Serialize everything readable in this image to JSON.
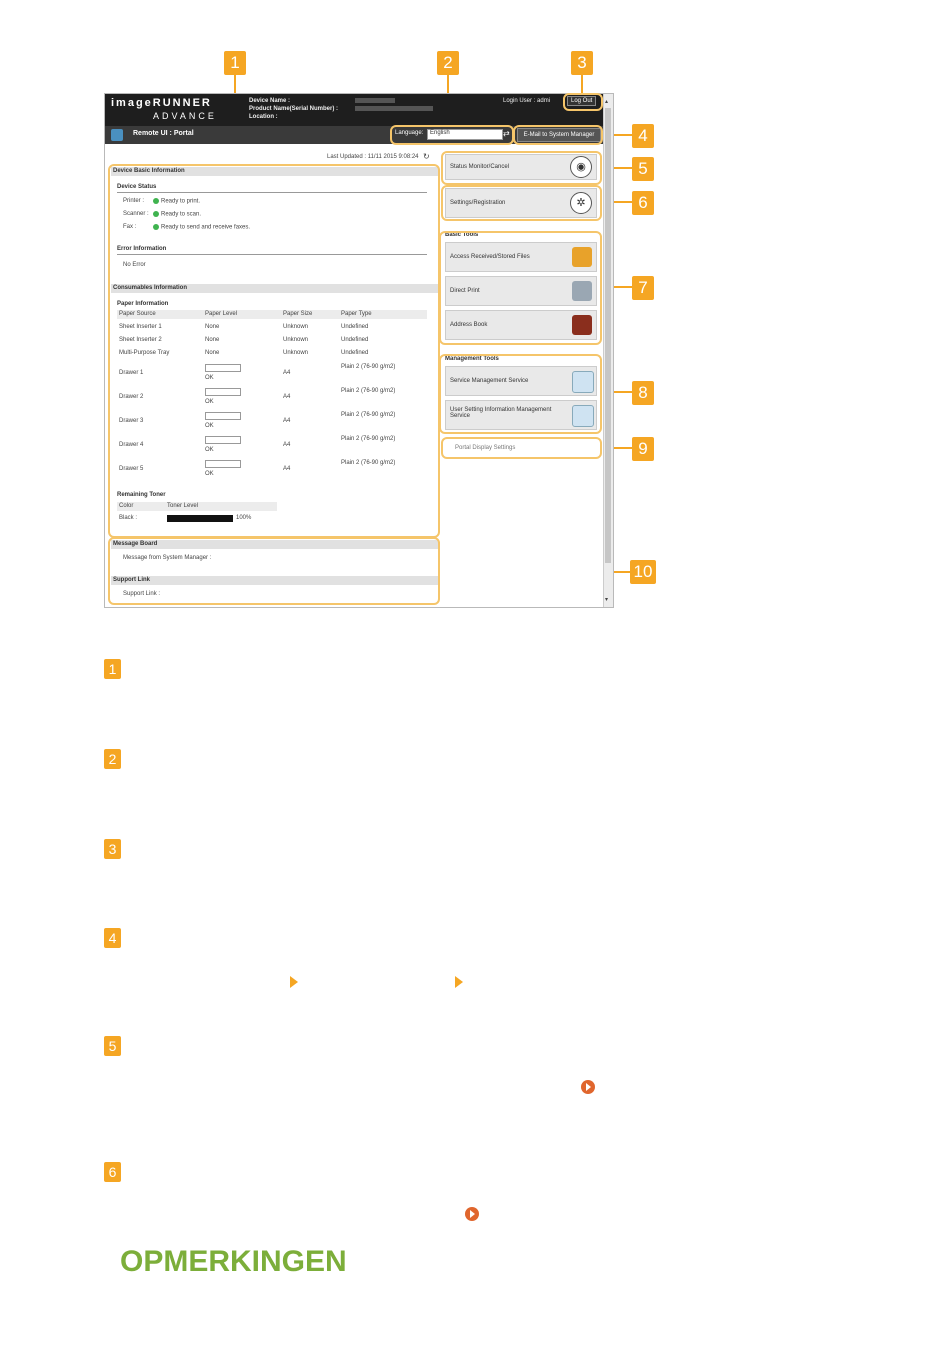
{
  "callouts": [
    "1",
    "2",
    "3",
    "4",
    "5",
    "6",
    "7",
    "8",
    "9",
    "10"
  ],
  "header": {
    "brand_line1": "imageRUNNER",
    "brand_line2": "ADVANCE",
    "device_name_label": "Device Name :",
    "product_name_label": "Product Name(Serial Number) :",
    "location_label": "Location :",
    "login_user_label": "Login User :",
    "login_user_value": "admi",
    "logout_label": "Log Out"
  },
  "toolbar": {
    "title": "Remote UI : Portal",
    "language_label": "Language:",
    "language_value": "English",
    "mail_button": "E-Mail to System Manager"
  },
  "last_updated": "Last Updated : 11/11 2015 9:08:24",
  "device_basic": {
    "section_title": "Device Basic Information",
    "status_title": "Device Status",
    "statuses": [
      {
        "label": "Printer :",
        "value": "Ready to print."
      },
      {
        "label": "Scanner :",
        "value": "Ready to scan."
      },
      {
        "label": "Fax :",
        "value": "Ready to send and receive faxes."
      }
    ],
    "error_title": "Error Information",
    "error_value": "No Error"
  },
  "consumables": {
    "section_title": "Consumables Information",
    "paper_title": "Paper Information",
    "columns": [
      "Paper Source",
      "Paper Level",
      "Paper Size",
      "Paper Type"
    ],
    "rows": [
      {
        "source": "Sheet Inserter 1",
        "level": "None",
        "size": "Unknown",
        "type": "Undefined"
      },
      {
        "source": "Sheet Inserter 2",
        "level": "None",
        "size": "Unknown",
        "type": "Undefined"
      },
      {
        "source": "Multi-Purpose Tray",
        "level": "None",
        "size": "Unknown",
        "type": "Undefined"
      },
      {
        "source": "Drawer 1",
        "level": "OK",
        "size": "A4",
        "type": "Plain 2 (76-90 g/m2)"
      },
      {
        "source": "Drawer 2",
        "level": "OK",
        "size": "A4",
        "type": "Plain 2 (76-90 g/m2)"
      },
      {
        "source": "Drawer 3",
        "level": "OK",
        "size": "A4",
        "type": "Plain 2 (76-90 g/m2)"
      },
      {
        "source": "Drawer 4",
        "level": "OK",
        "size": "A4",
        "type": "Plain 2 (76-90 g/m2)"
      },
      {
        "source": "Drawer 5",
        "level": "OK",
        "size": "A4",
        "type": "Plain 2 (76-90 g/m2)"
      }
    ],
    "toner_title": "Remaining Toner",
    "toner_columns": [
      "Color",
      "Toner Level"
    ],
    "toner_rows": [
      {
        "color": "Black :",
        "percent": "100%"
      }
    ]
  },
  "message_board": {
    "title": "Message Board",
    "text": "Message from System Manager :"
  },
  "support": {
    "title": "Support Link",
    "text": "Support Link :"
  },
  "right_panel": {
    "status_monitor": "Status Monitor/Cancel",
    "settings": "Settings/Registration",
    "basic_tools_title": "Basic Tools",
    "basic_tools": [
      "Access Received/Stored Files",
      "Direct Print",
      "Address Book"
    ],
    "management_title": "Management Tools",
    "management_tools": [
      "Service Management Service",
      "User Setting Information Management Service"
    ],
    "portal_display": "Portal Display Settings"
  },
  "page_numbers": [
    "1",
    "2",
    "3",
    "4",
    "5",
    "6"
  ],
  "note_heading": "OPMERKINGEN",
  "colors": {
    "accent": "#f5a623",
    "note": "#7cae3a",
    "link_circle": "#e0662d",
    "status_ok": "#3fb34f"
  }
}
